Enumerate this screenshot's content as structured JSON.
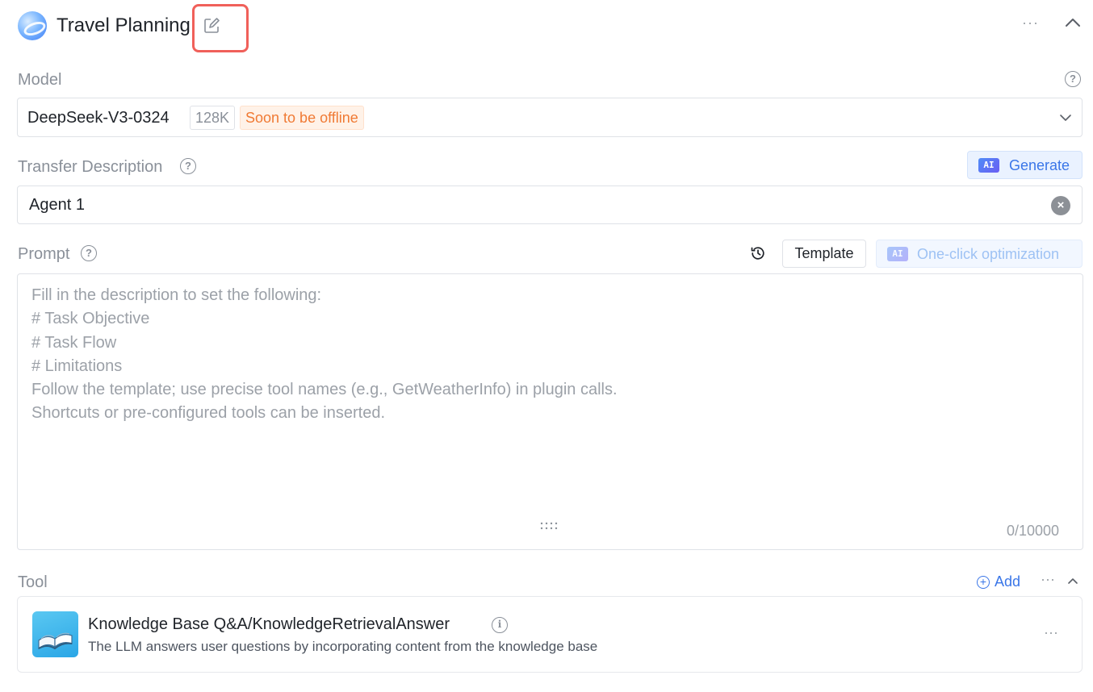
{
  "header": {
    "title": "Travel Planning",
    "edit_icon": "edit-icon",
    "more_label": "···",
    "collapse_icon": "chevron-up-icon"
  },
  "model": {
    "label": "Model",
    "help": "?",
    "selected": "DeepSeek-V3-0324",
    "context_tag": "128K",
    "status_tag": "Soon to be offline",
    "dropdown_icon": "chevron-down-icon"
  },
  "transfer_description": {
    "label": "Transfer Description",
    "help": "?",
    "generate_chip": "AI",
    "generate_label": "Generate",
    "value": "Agent 1",
    "clear_glyph": "×"
  },
  "prompt": {
    "label": "Prompt",
    "help": "?",
    "history_icon": "history-icon",
    "template_label": "Template",
    "optimize_chip": "AI",
    "optimize_label": "One-click optimization",
    "placeholder": "Fill in the description to set the following:\n# Task Objective\n# Task Flow\n# Limitations\nFollow the template; use precise tool names (e.g., GetWeatherInfo) in plugin calls.\nShortcuts or pre-configured tools can be inserted.",
    "counter": "0/10000"
  },
  "tool": {
    "label": "Tool",
    "add_label": "Add",
    "add_glyph": "+",
    "more_label": "···",
    "items": [
      {
        "name": "Knowledge Base Q&A/KnowledgeRetrievalAnswer",
        "info": "i",
        "description": "The LLM answers user questions by incorporating content from the knowledge base",
        "icon": "book-icon",
        "more_label": "···"
      }
    ]
  },
  "colors": {
    "accent": "#3a76e8",
    "warning": "#f07a34",
    "highlight_box": "#f0605a"
  }
}
